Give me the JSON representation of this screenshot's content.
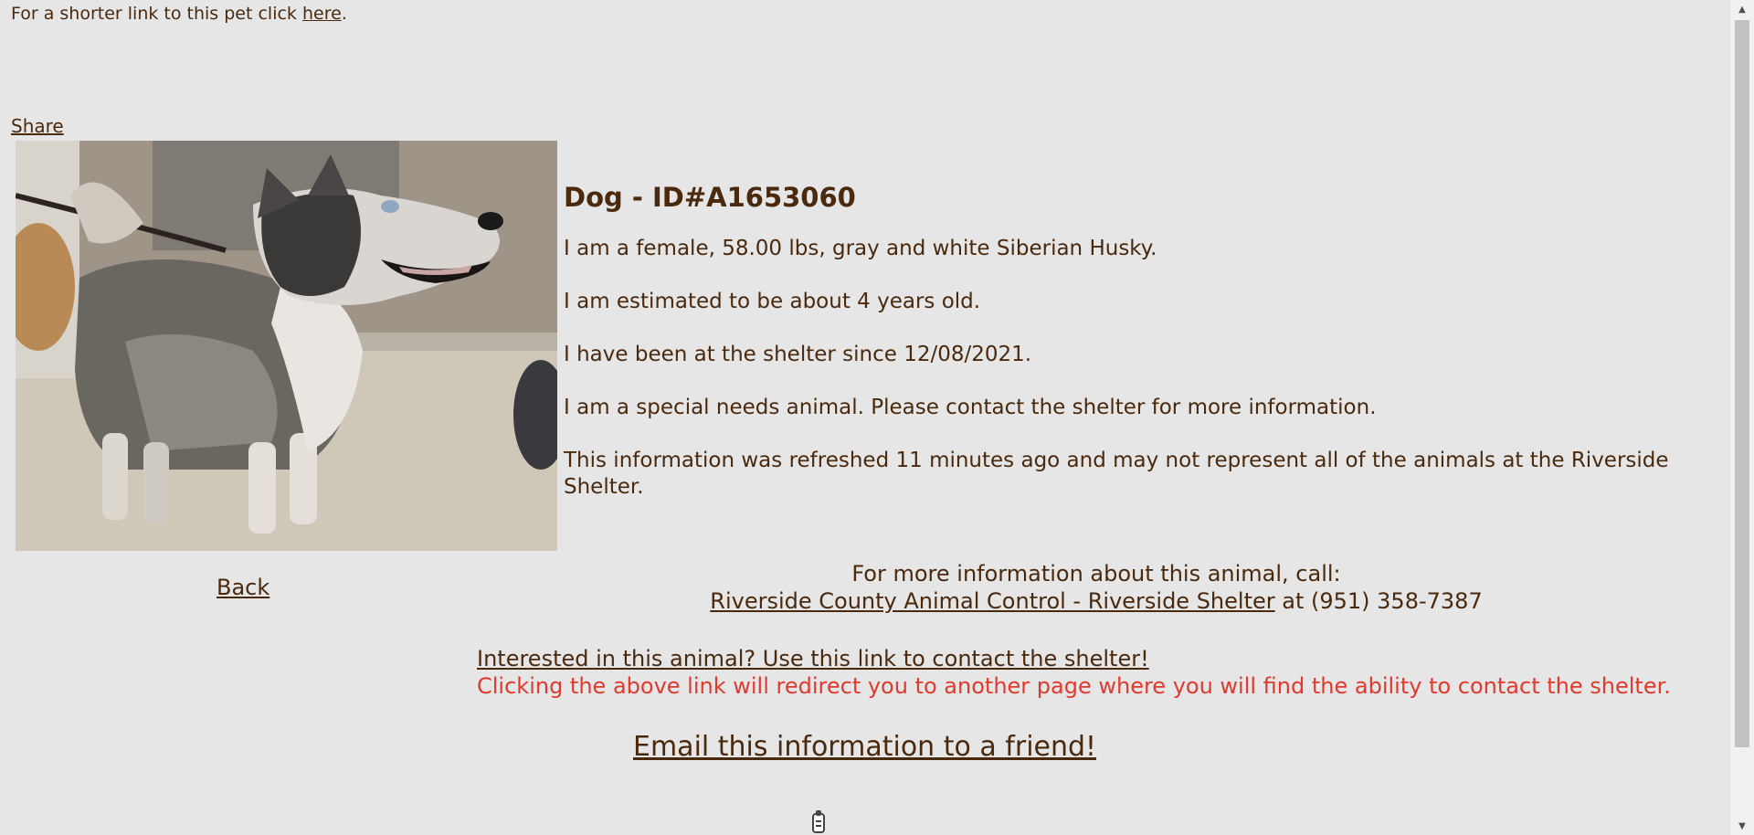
{
  "header": {
    "shorter_link_prefix": "For a shorter link to this pet click ",
    "shorter_link_label": "here",
    "shorter_link_suffix": ".",
    "share_label": "Share"
  },
  "animal": {
    "title": "Dog - ID#A1653060",
    "description": "I am a female, 58.00 lbs, gray and white Siberian Husky.",
    "age": "I am estimated to be about 4 years old.",
    "since": "I have been at the shelter since 12/08/2021.",
    "special_needs": "I am a special needs animal. Please contact the shelter for more information.",
    "refreshed": "This information was refreshed 11 minutes ago and may not represent all of the animals at the Riverside Shelter."
  },
  "navigation": {
    "back_label": "Back"
  },
  "contact": {
    "intro": "For more information about this animal, call:",
    "shelter_name": "Riverside County Animal Control - Riverside Shelter",
    "phone_prefix": " at (951) 358-7387"
  },
  "interest": {
    "link_label": "Interested in this animal? Use this link to contact the shelter!",
    "redirect_note": "Clicking the above link will redirect you to another page where you will find the ability to contact the shelter."
  },
  "email": {
    "link_label": "Email this information to a friend!"
  },
  "colors": {
    "background": "#e6e6e6",
    "text": "#4a2a0f",
    "warning": "#e03a2f"
  },
  "icons": {
    "photo": "husky-photo",
    "bottom": "share-widget-icon"
  }
}
